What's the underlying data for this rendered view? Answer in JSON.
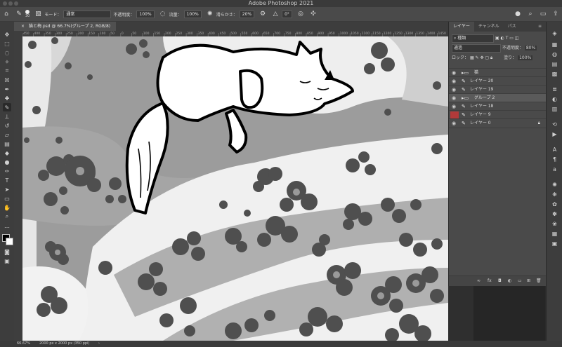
{
  "app": {
    "title": "Adobe Photoshop 2021"
  },
  "options": {
    "brush_size": "30",
    "mode_label": "モード：",
    "mode_value": "通常",
    "opacity_label": "不透明度：",
    "opacity_value": "100%",
    "flow_label": "流量：",
    "flow_value": "100%",
    "smoothing_label": "滑らかさ：",
    "smoothing_value": "20%",
    "angle_value": "0°"
  },
  "doc": {
    "tab_title": "猫と梅.psd @ 66.7%(グループ 2, RGB/8)"
  },
  "ruler": {
    "ticks": [
      "450",
      "400",
      "350",
      "300",
      "250",
      "200",
      "150",
      "100",
      "50",
      "0",
      "50",
      "100",
      "150",
      "200",
      "250",
      "300",
      "350",
      "400",
      "450",
      "500",
      "550",
      "600",
      "650",
      "700",
      "750",
      "800",
      "850",
      "900",
      "950",
      "1000",
      "1050",
      "1100",
      "1150",
      "1200",
      "1250",
      "1300",
      "1350",
      "1400",
      "1450"
    ]
  },
  "panel": {
    "tabs": [
      "レイヤー",
      "チャンネル",
      "パス"
    ],
    "filter_label": "種類",
    "blend_mode": "通過",
    "opacity_label": "不透明度：",
    "opacity_value": "80%",
    "lock_label": "ロック：",
    "fill_label": "塗り：",
    "fill_value": "100%",
    "layers": [
      {
        "name": "猫",
        "kind": "folder"
      },
      {
        "name": "レイヤー 20",
        "kind": "layer"
      },
      {
        "name": "レイヤー 19",
        "kind": "layer"
      },
      {
        "name": "グループ 2",
        "kind": "folder"
      },
      {
        "name": "レイヤー 18",
        "kind": "layer"
      },
      {
        "name": "レイヤー 9",
        "kind": "layer"
      },
      {
        "name": "レイヤー 0",
        "kind": "layer"
      }
    ]
  },
  "status": {
    "zoom": "66.67%",
    "doc_info": "2000 px x 2000 px (350 ppi)"
  }
}
